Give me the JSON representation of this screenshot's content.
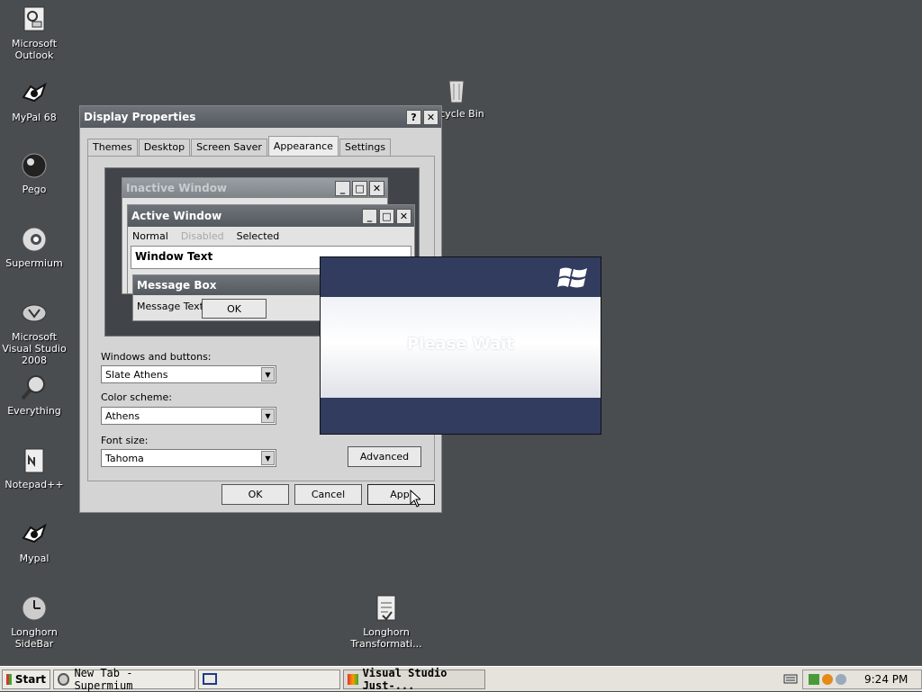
{
  "desktop_icons": [
    {
      "label": "Microsoft Outlook",
      "icon": "outlook-icon"
    },
    {
      "label": "MyPal 68",
      "icon": "mypal-icon"
    },
    {
      "label": "Pego",
      "icon": "pego-icon"
    },
    {
      "label": "Supermium",
      "icon": "supermium-icon"
    },
    {
      "label": "Microsoft Visual Studio 2008",
      "icon": "visual-studio-icon"
    },
    {
      "label": "Everything",
      "icon": "search-icon"
    },
    {
      "label": "Notepad++",
      "icon": "notepad-icon"
    },
    {
      "label": "Mypal",
      "icon": "mypal-icon"
    },
    {
      "label": "Longhorn SideBar",
      "icon": "sidebar-icon"
    },
    {
      "label": "cycle Bin",
      "icon": "recycle-bin-icon"
    },
    {
      "label": "Longhorn Transformati...",
      "icon": "transformation-icon"
    }
  ],
  "dialog": {
    "title": "Display Properties",
    "help_btn": "?",
    "close_btn": "✕",
    "tabs": [
      "Themes",
      "Desktop",
      "Screen Saver",
      "Appearance",
      "Settings"
    ],
    "selected_tab": "Appearance",
    "preview": {
      "inactive_title": "Inactive Window",
      "active_title": "Active Window",
      "menu": [
        "Normal",
        "Disabled",
        "Selected"
      ],
      "window_text": "Window Text",
      "msgbox_title": "Message Box",
      "msgbox_text": "Message Text",
      "msgbox_ok": "OK"
    },
    "windows_buttons_label": "Windows and buttons:",
    "windows_buttons_value": "Slate Athens",
    "color_scheme_label": "Color scheme:",
    "color_scheme_value": "Athens",
    "font_size_label": "Font size:",
    "font_size_value": "Tahoma",
    "advanced_btn": "Advanced",
    "ok_btn": "OK",
    "cancel_btn": "Cancel",
    "apply_btn": "Appl"
  },
  "splash": {
    "text": "Please Wait",
    "logo": "windows-logo-icon",
    "accent": "#313c5f"
  },
  "taskbar": {
    "start": "Start",
    "tasks": [
      "New Tab - Supermium",
      "",
      "Visual Studio Just-..."
    ],
    "clock": "9:24 PM"
  }
}
